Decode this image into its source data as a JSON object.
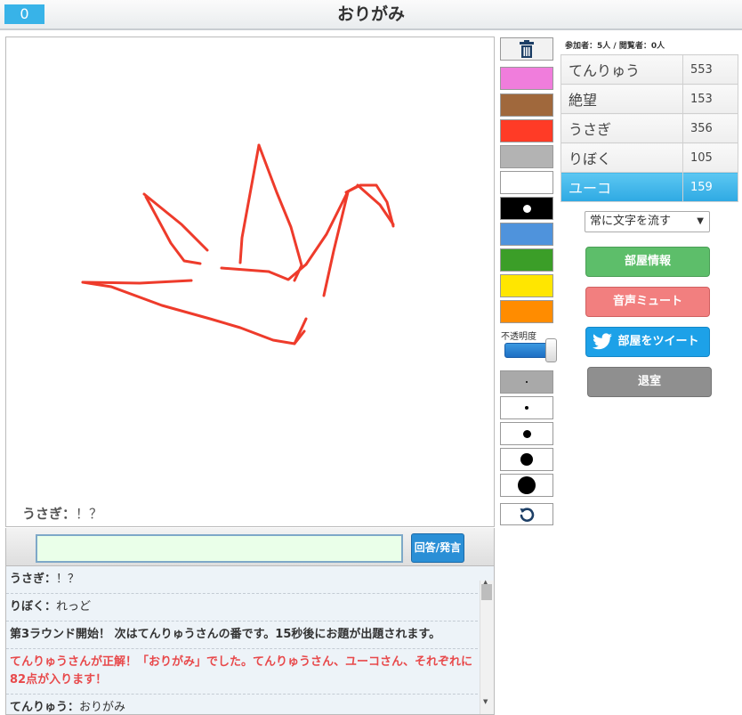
{
  "header": {
    "counter": "0",
    "title": "おりがみ"
  },
  "canvas": {
    "caption_name": "うさぎ",
    "caption_sep": "：",
    "caption_text": "！？",
    "stroke_color": "#ee3b2b"
  },
  "palette": {
    "colors": [
      "#f07ddc",
      "#a0683c",
      "#ff3b26",
      "#b3b3b3",
      "#ffffff",
      "#000000",
      "#4f93dc",
      "#3b9e28",
      "#ffe600",
      "#ff8c00"
    ],
    "selected_index": 5,
    "opacity_label": "不透明度",
    "opacity_value": 1.0,
    "brush_sizes": [
      2,
      4,
      9,
      14,
      20
    ],
    "selected_size_index": 0
  },
  "right": {
    "viewer_stats": "参加者：5人 / 閲覧者：0人",
    "ranking": [
      {
        "name": "てんりゅう",
        "score": "553"
      },
      {
        "name": "絶望",
        "score": "153"
      },
      {
        "name": "うさぎ",
        "score": "356"
      },
      {
        "name": "りぼく",
        "score": "105"
      },
      {
        "name": "ユーコ",
        "score": "159"
      }
    ],
    "scroll_option": "常に文字を流す",
    "buttons": {
      "room_info": "部屋情報",
      "mute": "音声ミュート",
      "tweet": "部屋をツイート",
      "leave": "退室"
    }
  },
  "input": {
    "value": "",
    "submit_label": "回答/発言"
  },
  "chat": [
    {
      "name": "うさぎ",
      "sep": "：",
      "text": "！？"
    },
    {
      "name": "りぼく",
      "sep": "：",
      "text": "れっど"
    },
    {
      "text": "第3ラウンド開始！ 次はてんりゅうさんの番です。15秒後にお題が出題されます。"
    },
    {
      "text": "てんりゅうさんが正解！「おりがみ」でした。てんりゅうさん、ユーコさん、それぞれに82点が入ります！"
    },
    {
      "name": "てんりゅう",
      "sep": "：",
      "text": "おりがみ"
    }
  ]
}
